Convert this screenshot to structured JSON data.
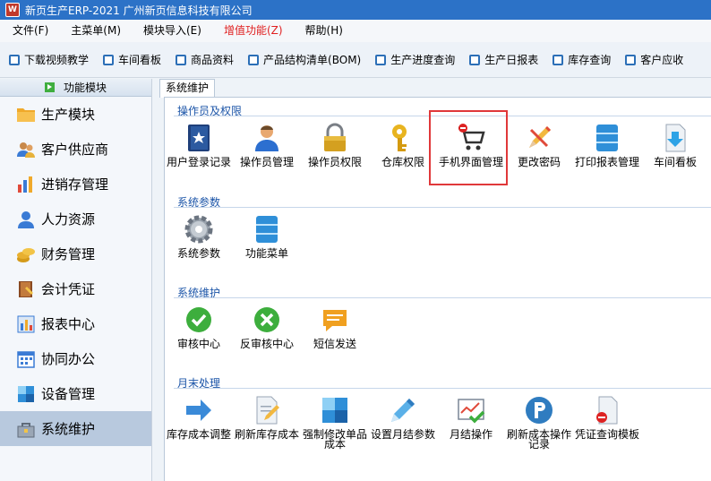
{
  "window": {
    "title": "新页生产ERP-2021 广州新页信息科技有限公司"
  },
  "menu": [
    "文件(F)",
    "主菜单(M)",
    "模块导入(E)",
    "增值功能(Z)",
    "帮助(H)"
  ],
  "toolbar": [
    "下载视频教学",
    "车间看板",
    "商品资料",
    "产品结构清单(BOM)",
    "生产进度查询",
    "生产日报表",
    "库存查询",
    "客户应收"
  ],
  "left_panel": {
    "header": "功能模块",
    "items": [
      "生产模块",
      "客户供应商",
      "进销存管理",
      "人力资源",
      "财务管理",
      "会计凭证",
      "报表中心",
      "协同办公",
      "设备管理",
      "系统维护"
    ],
    "active": "系统维护"
  },
  "tab": "系统维护",
  "sections": {
    "s1": {
      "title": "操作员及权限",
      "items": [
        "用户登录记录",
        "操作员管理",
        "操作员权限",
        "仓库权限",
        "手机界面管理",
        "更改密码",
        "打印报表管理",
        "车间看板"
      ]
    },
    "s2": {
      "title": "系统参数",
      "items": [
        "系统参数",
        "功能菜单"
      ]
    },
    "s3": {
      "title": "系统维护",
      "items": [
        "审核中心",
        "反审核中心",
        "短信发送"
      ]
    },
    "s4": {
      "title": "月末处理",
      "items": [
        "库存成本调整",
        "刷新库存成本",
        "强制修改单品成本",
        "设置月结参数",
        "月结操作",
        "刷新成本操作记录",
        "凭证查询模板"
      ]
    }
  },
  "colors": {
    "titlebar": "#2c72c7",
    "section_title": "#1c55a8",
    "highlight_border": "#e0383a",
    "menu_highlight": "#e02020"
  }
}
